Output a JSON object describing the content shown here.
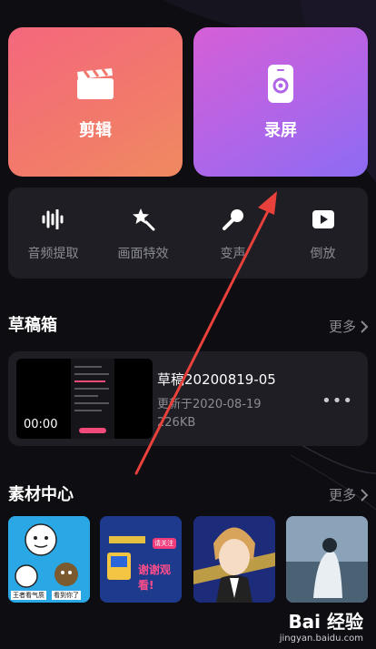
{
  "cards": {
    "edit_label": "剪辑",
    "record_label": "录屏"
  },
  "tools": [
    {
      "label": "音频提取",
      "icon": "audio-wave-icon"
    },
    {
      "label": "画面特效",
      "icon": "magic-wand-icon"
    },
    {
      "label": "变声",
      "icon": "microphone-icon"
    },
    {
      "label": "倒放",
      "icon": "play-icon"
    }
  ],
  "drafts": {
    "title": "草稿箱",
    "more_label": "更多",
    "item": {
      "name": "草稿20200819-05",
      "updated": "更新于2020-08-19",
      "size": "226KB",
      "duration": "00:00",
      "menu": "•••"
    }
  },
  "materials": {
    "title": "素材中心",
    "more_label": "更多",
    "items": [
      {
        "name": "sticker-pack-1",
        "captions": [
          "王者看气质",
          "看到你了"
        ]
      },
      {
        "name": "thanks-for-watching",
        "captions": [
          "谢谢观看!",
          "请关注"
        ]
      },
      {
        "name": "anime-character"
      },
      {
        "name": "photo-figure"
      }
    ]
  },
  "watermark": {
    "brand": "Bai 经验",
    "url": "jingyan.baidu.com"
  },
  "colors": {
    "edit_card": "#f2786c",
    "record_card": "#b065e8",
    "arrow": "#e8403a"
  }
}
